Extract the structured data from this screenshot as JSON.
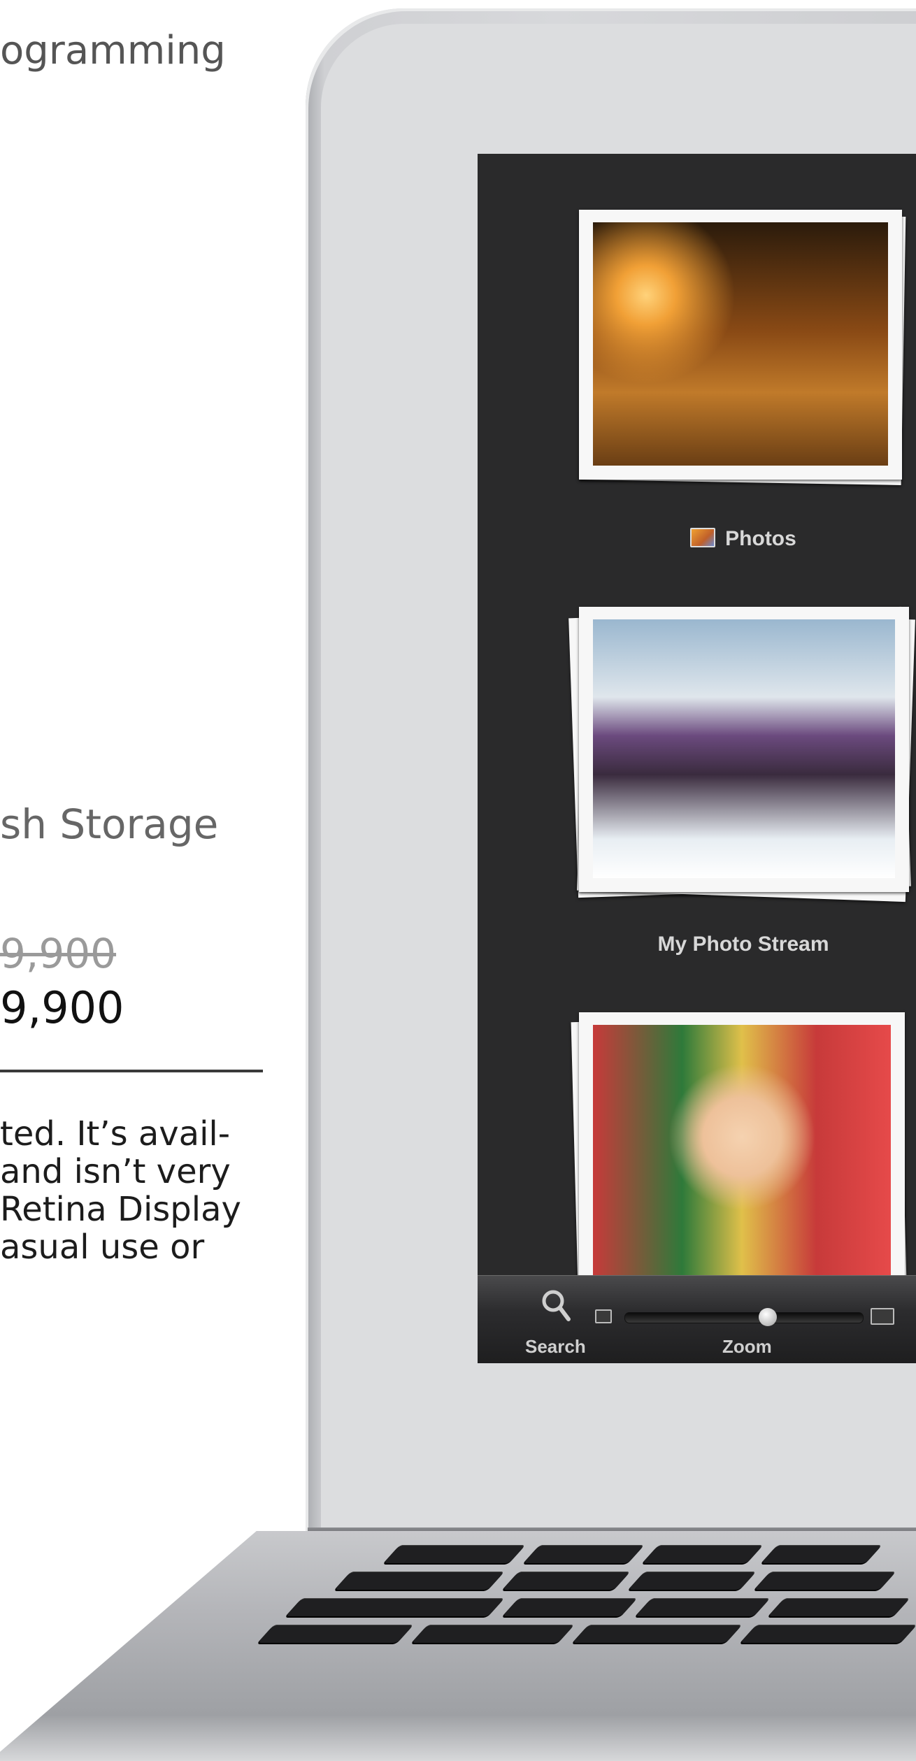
{
  "left_column": {
    "heading_fragment": "ogramming",
    "storage_fragment": "sh Storage",
    "old_price_fragment": "9,900",
    "new_price_fragment": "9,900",
    "description_lines": [
      "ted. It’s avail-",
      "and isn’t very",
      " Retina Display",
      "asual use or"
    ]
  },
  "screen": {
    "albums": [
      {
        "label": "Photos"
      },
      {
        "label": "My Photo Stream"
      }
    ],
    "toolbar": {
      "search_label": "Search",
      "zoom_label": "Zoom",
      "zoom_level": 0.6
    }
  }
}
